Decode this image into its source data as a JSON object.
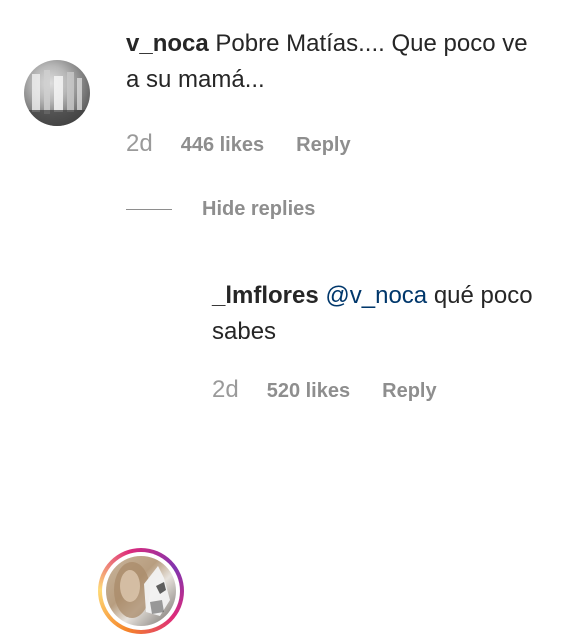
{
  "comments": [
    {
      "username": "v_noca",
      "text": "Pobre Matías.... Que poco ve a su mamá...",
      "time": "2d",
      "likes": "446 likes",
      "reply_label": "Reply"
    }
  ],
  "replies_toggle": {
    "label": "Hide replies"
  },
  "replies": [
    {
      "username": "_lmflores",
      "mention": "@v_noca",
      "text": "qué poco sabes",
      "time": "2d",
      "likes": "520 likes",
      "reply_label": "Reply"
    }
  ],
  "colors": {
    "text": "#262626",
    "meta": "#8e8e8e",
    "mention": "#00376b",
    "story_ring": [
      "#f58529",
      "#feda77",
      "#dd2a7b",
      "#8134af"
    ]
  }
}
